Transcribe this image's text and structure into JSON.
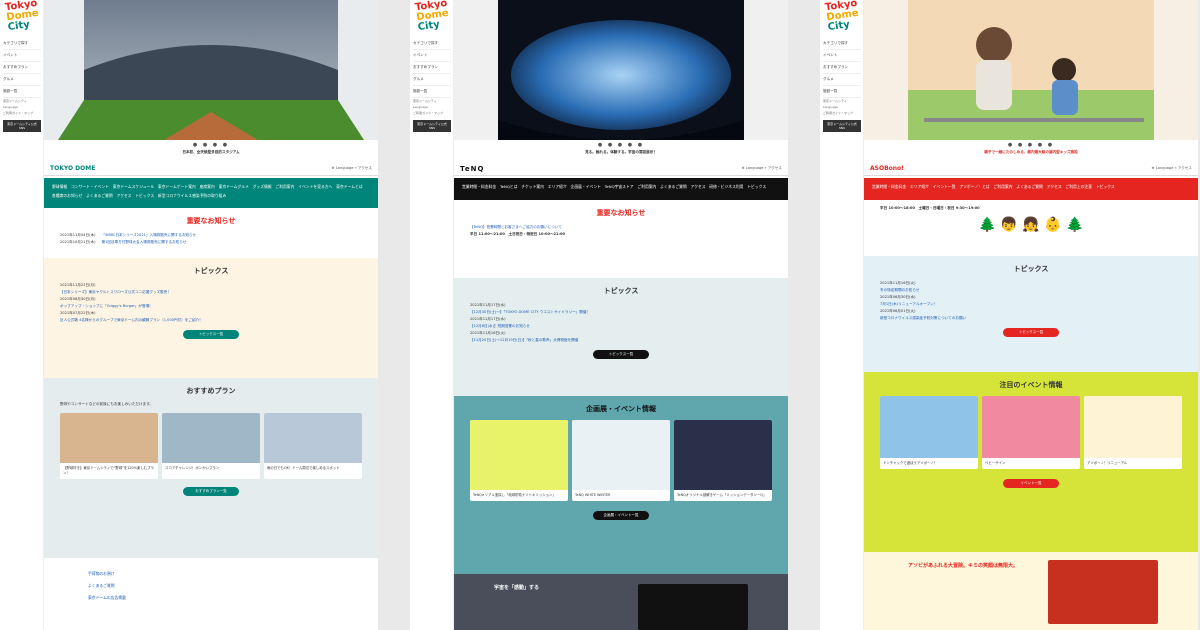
{
  "panel1": {
    "logo": [
      "Tokyo",
      "Dome",
      "City"
    ],
    "side": [
      "カテゴリで探す",
      "イベント",
      "おすすめプラン",
      "グルメ",
      "施設一覧"
    ],
    "side_small": [
      "東京ドームシティ",
      "Language",
      "ご利用ガイド・マップ"
    ],
    "side_btn": "東京ドームシティ公式SNS",
    "hero_caption": "日本初、全天候型多目的スタジアム",
    "dots": "● ● ● ●",
    "title": "TOKYO DOME",
    "lang": "Language",
    "access": "アクセス",
    "menu": "野球情報　コンサート・イベント　東京ドームスケジュール　東京ドームゲート案内　座席案内　東京ドームグルメ　グッズ情報　ご利用案内　イベントを見る方へ　東京ドームとは　各種席のお知らせ　よくあるご質問　アクセス　トピックス　新型コロナウイルス感染予防の取り組み",
    "notice_head": "重要なお知らせ",
    "notices": [
      {
        "d": "2021年11月04日(木)",
        "t": "「SMBC日本シリーズ2021」入場券販売に関するお知らせ"
      },
      {
        "d": "2021年10月21日(木)",
        "t": "第1回目車方付野球大会入場券販売に関するお知らせ"
      }
    ],
    "topics_head": "トピックス",
    "topics": [
      {
        "d": "2021年11月22日(月)",
        "t": "【日本シリーズ】東京ヤクルトスワローズ公式ユニ応援グッズ販売！"
      },
      {
        "d": "2021年08月30日(月)",
        "t": "ポップアップ・ショップに「Griggy's Burger」が登場！"
      },
      {
        "d": "2021年07月22日(木)",
        "t": "巨人公式戦 4名様からのグループで東京ドーム内の観戦プラン（1,000円付）をご紹介！"
      }
    ],
    "topics_btn": "トピックス一覧",
    "plan_head": "おすすめプラン",
    "plan_intro": "野球やコンサートなどの前後にもお楽しみいただけます。",
    "plans": [
      "【野球好き】東京ドームシティで“野球”を120%楽しむプラン！",
      "スコアチャレンジ！ボンかいプラン",
      "雨の日でもOK！ドーム周辺で楽しめるスポット"
    ],
    "plan_btn": "おすすめプラン一覧",
    "bottom": [
      "手荷物のお預け",
      "よくあるご質問",
      "東京ドームの広告掲載"
    ]
  },
  "panel2": {
    "logo": [
      "Tokyo",
      "Dome",
      "City"
    ],
    "side": [
      "カテゴリで探す",
      "イベント",
      "おすすめプラン",
      "グルメ",
      "施設一覧"
    ],
    "side_small": [
      "東京ドームシティ",
      "Language",
      "ご利用ガイド・マップ"
    ],
    "side_btn": "東京ドームシティ公式SNS",
    "hero_caption": "見る。触れる。体験する。宇宙の常設展示！",
    "dots": "● ● ● ● ●",
    "title": "TeNQ",
    "lang": "Language",
    "access": "アクセス",
    "menu": "営業時間・料金料金　TeNQとは　チケット案内　エリア紹介　企画展・イベント　TeNQ宇宙ストア　ご利用案内　よくあるご質問　アクセス　研修・ビジネス利用　トピックス",
    "notice_head": "重要なお知らせ",
    "notice": "【TeNQ】営業時間とお客さまへご協力のお願いについて",
    "hours": "平日 11:00〜21:00　土日祝日・特定日 10:00〜21:00",
    "topics_head": "トピックス",
    "topics": [
      {
        "d": "2021年11月17日(水)",
        "t": "【12月30日(土)〜】「TOKYO DOME CITY ウエストサイドラリー」開催！"
      },
      {
        "d": "2021年11月17日(水)",
        "t": "【12月8日(水)】短期営業のお知らせ"
      },
      {
        "d": "2021年11月16日(火)",
        "t": "【11月20日(土)〜12月19日(日)】「秋と星の歌声」大博物館を開催"
      }
    ],
    "topics_btn": "トピックス一覧",
    "event_head": "企画展・イベント情報",
    "events": [
      "TeNQ×リアル宝探し「地球防衛ナゾトキミッション」",
      "TeNQ WHITE WINTER",
      "TeNQオリジナル謎解きゲーム「ミッションデータシーQ」"
    ],
    "event_btn": "企画展・イベント一覧",
    "bottom_head": "宇宙を「感動」する"
  },
  "panel3": {
    "logo": [
      "Tokyo",
      "Dome",
      "City"
    ],
    "side": [
      "カテゴリで探す",
      "イベント",
      "おすすめプラン",
      "グルメ",
      "施設一覧"
    ],
    "side_small": [
      "東京ドームシティ",
      "Language",
      "ご利用ガイド・マップ"
    ],
    "side_btn": "東京ドームシティ公式SNS",
    "hero_caption": "親子で一緒にたのしめる、都内最大級の屋内型キッズ施設",
    "dots": "● ● ● ● ●",
    "title": "ASOBono!",
    "lang": "Language",
    "access": "アクセス",
    "menu": "営業時間・料金料金　エリア紹介　イベント一覧　アソボ〜ノ！とは　ご利用案内　よくあるご質問　アクセス　ご利用上の注意　トピックス",
    "hours": "平日 10:00〜18:00　土曜日・日曜日・祝日 9:30〜19:00",
    "topics_head": "トピックス",
    "topics": [
      {
        "d": "2021年11月16日(火)",
        "t": "冬の特定期間のお知らせ"
      },
      {
        "d": "2021年06月30日(水)",
        "t": "7月1日(木)リニューアルオープン！"
      },
      {
        "d": "2021年06月01日(火)",
        "t": "新型コロナウイルス感染症予防対策についてのお願い"
      }
    ],
    "topics_btn": "トピックス一覧",
    "event_head": "注目のイベント情報",
    "events": [
      "ドンチャックで遊ぼうアソボーノ！",
      "ベビーサイン",
      "アソボーノ！リニューアル"
    ],
    "event_btn": "イベント一覧",
    "bottom_head": "アソビがあふれる大冒険。キミの笑顔は無限大。"
  },
  "colors": {
    "dome": "#00857a",
    "tenq": "#111111",
    "asobono": "#e52620",
    "yellow": "#f2c200"
  }
}
